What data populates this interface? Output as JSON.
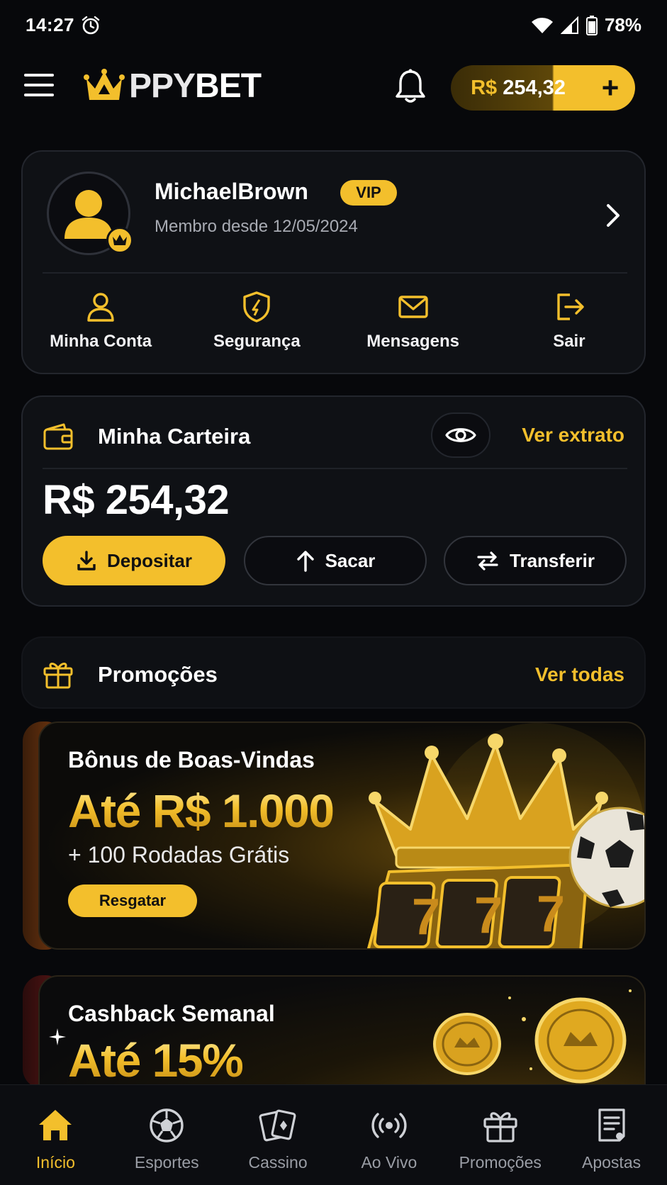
{
  "status_bar": {
    "time": "14:27",
    "battery": "78%"
  },
  "header": {
    "logo_part1": "PPY",
    "logo_part2": "BET",
    "balance_currency": "R$",
    "balance_value": "254,32",
    "add_label": "+"
  },
  "profile": {
    "username": "MichaelBrown",
    "badge": "VIP",
    "member_since": "Membro desde 12/05/2024",
    "actions": [
      {
        "label": "Minha Conta",
        "icon": "user-icon"
      },
      {
        "label": "Segurança",
        "icon": "shield-icon"
      },
      {
        "label": "Mensagens",
        "icon": "mail-icon"
      },
      {
        "label": "Sair",
        "icon": "logout-icon"
      }
    ]
  },
  "wallet": {
    "title": "Minha Carteira",
    "statement_link": "Ver extrato",
    "amount": "R$ 254,32",
    "buttons": {
      "deposit": "Depositar",
      "withdraw": "Sacar",
      "transfer": "Transferir"
    }
  },
  "promotions": {
    "title": "Promoções",
    "see_all": "Ver todas",
    "banners": [
      {
        "subtitle": "Bônus de Boas-Vindas",
        "headline": "Até R$ 1.000",
        "extra": "+ 100 Rodadas Grátis",
        "button": "Resgatar"
      },
      {
        "subtitle": "Cashback Semanal",
        "headline": "Até 15%"
      }
    ]
  },
  "bottom_nav": [
    {
      "label": "Início",
      "icon": "home-icon",
      "active": true
    },
    {
      "label": "Esportes",
      "icon": "soccer-ball-icon"
    },
    {
      "label": "Cassino",
      "icon": "cards-icon"
    },
    {
      "label": "Ao Vivo",
      "icon": "live-broadcast-icon"
    },
    {
      "label": "Promoções",
      "icon": "gift-icon"
    },
    {
      "label": "Apostas",
      "icon": "receipt-icon"
    }
  ],
  "colors": {
    "accent": "#f3bf2c",
    "background": "#07080b",
    "card": "#0f1115",
    "muted_text": "#a8abb3"
  }
}
